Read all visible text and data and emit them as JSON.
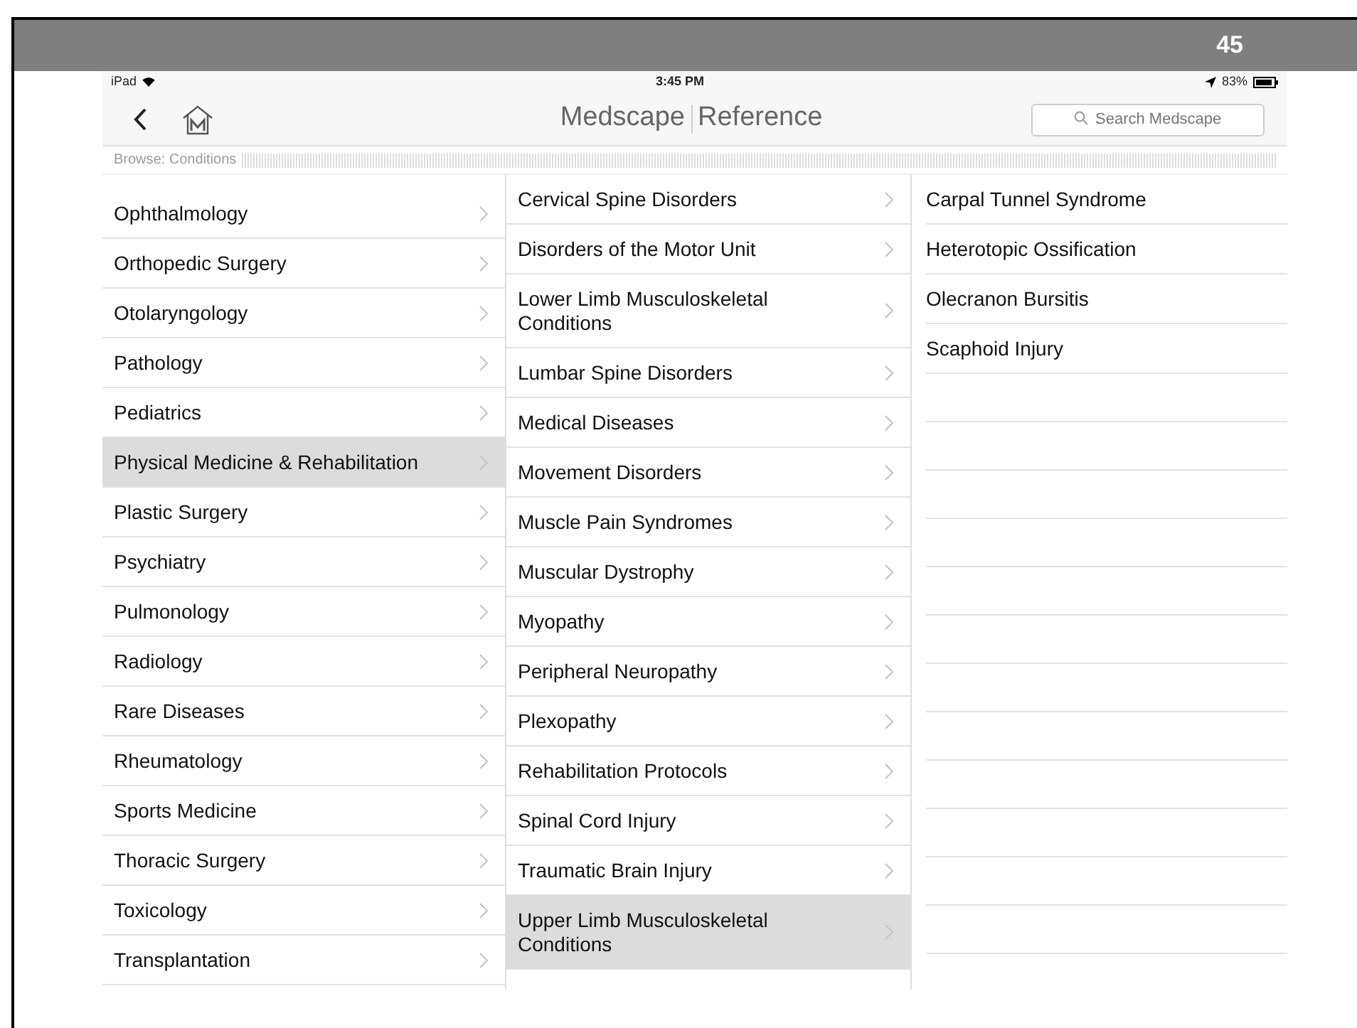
{
  "slide_number": "45",
  "status_bar": {
    "device": "iPad",
    "time": "3:45 PM",
    "battery": "83%"
  },
  "nav_bar": {
    "title": "Medscape",
    "subtitle": "Reference",
    "search": {
      "placeholder": "Search Medscape"
    }
  },
  "breadcrumb": "Browse: Conditions",
  "columns": [
    [
      {
        "label": "Ophthalmology",
        "selected": false
      },
      {
        "label": "Orthopedic Surgery",
        "selected": false
      },
      {
        "label": "Otolaryngology",
        "selected": false
      },
      {
        "label": "Pathology",
        "selected": false
      },
      {
        "label": "Pediatrics",
        "selected": false
      },
      {
        "label": "Physical Medicine & Rehabilitation",
        "selected": true
      },
      {
        "label": "Plastic Surgery",
        "selected": false
      },
      {
        "label": "Psychiatry",
        "selected": false
      },
      {
        "label": "Pulmonology",
        "selected": false
      },
      {
        "label": "Radiology",
        "selected": false
      },
      {
        "label": "Rare Diseases",
        "selected": false
      },
      {
        "label": "Rheumatology",
        "selected": false
      },
      {
        "label": "Sports Medicine",
        "selected": false
      },
      {
        "label": "Thoracic Surgery",
        "selected": false
      },
      {
        "label": "Toxicology",
        "selected": false
      },
      {
        "label": "Transplantation",
        "selected": false
      }
    ],
    [
      {
        "label": "Cervical Spine Disorders",
        "selected": false
      },
      {
        "label": "Disorders of the Motor Unit",
        "selected": false
      },
      {
        "label": "Lower Limb Musculoskeletal Conditions",
        "selected": false
      },
      {
        "label": "Lumbar Spine Disorders",
        "selected": false
      },
      {
        "label": "Medical Diseases",
        "selected": false
      },
      {
        "label": "Movement Disorders",
        "selected": false
      },
      {
        "label": "Muscle Pain Syndromes",
        "selected": false
      },
      {
        "label": "Muscular Dystrophy",
        "selected": false
      },
      {
        "label": "Myopathy",
        "selected": false
      },
      {
        "label": "Peripheral Neuropathy",
        "selected": false
      },
      {
        "label": "Plexopathy",
        "selected": false
      },
      {
        "label": "Rehabilitation Protocols",
        "selected": false
      },
      {
        "label": "Spinal Cord Injury",
        "selected": false
      },
      {
        "label": "Traumatic Brain Injury",
        "selected": false
      },
      {
        "label": "Upper Limb Musculoskeletal Conditions",
        "selected": true
      }
    ],
    [
      {
        "label": "Carpal Tunnel Syndrome"
      },
      {
        "label": "Heterotopic Ossification"
      },
      {
        "label": "Olecranon Bursitis"
      },
      {
        "label": "Scaphoid Injury"
      }
    ]
  ]
}
